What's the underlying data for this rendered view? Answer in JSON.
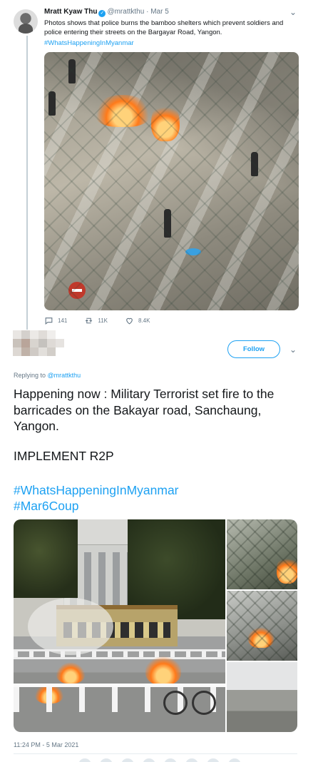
{
  "parent_tweet": {
    "name": "Mratt Kyaw Thu",
    "handle": "@mrattkthu",
    "separator": "·",
    "date": "Mar 5",
    "text": "Photos shows that police burns the bamboo shelters which prevent soldiers and police entering their streets on the Bargayar Road, Yangon.",
    "hashtag": "#WhatsHappeningInMyanmar",
    "replies": "141",
    "retweets": "11K",
    "likes": "8.4K"
  },
  "main_tweet": {
    "follow_label": "Follow",
    "replying_prefix": "Replying to ",
    "replying_handle": "@mrattkthu",
    "text": "Happening now : Military Terrorist set fire to the barricades on the Bakayar road, Sanchaung, Yangon.",
    "text2": "IMPLEMENT R2P",
    "hashtag1": "#WhatsHappeningInMyanmar",
    "hashtag2": "#Mar6Coup",
    "timestamp": "11:24 PM - 5 Mar 2021"
  },
  "colors": {
    "accent": "#1da1f2",
    "secondary_text": "#657786",
    "primary_text": "#14171a"
  }
}
